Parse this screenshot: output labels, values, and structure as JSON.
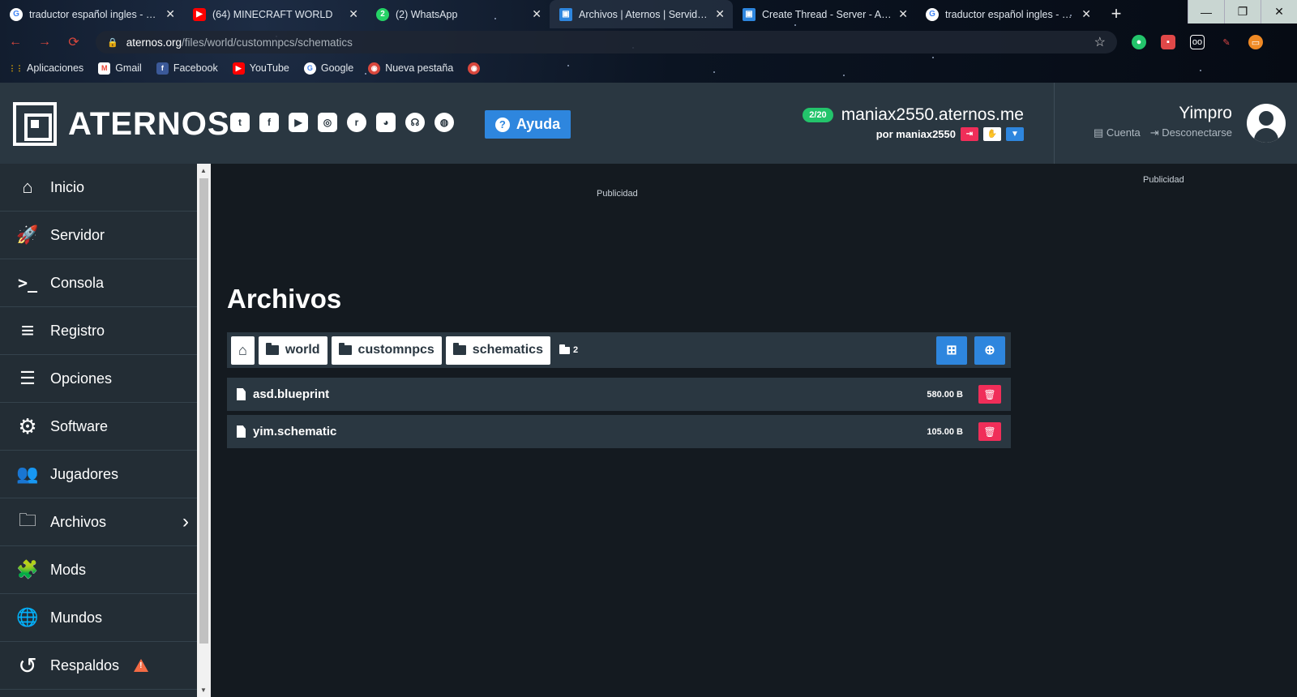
{
  "browser": {
    "tabs": [
      {
        "title": "traductor español ingles - Busc",
        "favicon": "G",
        "color": "#ffffff",
        "fg": "#4285f4",
        "active": false
      },
      {
        "title": "(64) MINECRAFT WORLD",
        "favicon": "▶",
        "color": "#ff0000",
        "fg": "#ffffff",
        "active": false
      },
      {
        "title": "(2) WhatsApp",
        "favicon": "2",
        "color": "#25d366",
        "fg": "#ffffff",
        "active": false
      },
      {
        "title": "Archivos | Aternos | Servidor d",
        "favicon": "▣",
        "color": "#2e86de",
        "fg": "#ffffff",
        "active": true
      },
      {
        "title": "Create Thread - Server - Atern",
        "favicon": "▣",
        "color": "#2e86de",
        "fg": "#ffffff",
        "active": false
      },
      {
        "title": "traductor español ingles - Busc",
        "favicon": "G",
        "color": "#ffffff",
        "fg": "#4285f4",
        "active": false
      }
    ],
    "close_glyph": "✕",
    "newtab_glyph": "+",
    "window_controls": {
      "minimize": "—",
      "restore": "❐",
      "close": "✕"
    },
    "nav": {
      "back": "←",
      "forward": "→",
      "reload": "⟳"
    },
    "url_host": "aternos.org",
    "url_path": "/files/world/customnpcs/schematics",
    "bookmarks": [
      {
        "label": "Aplicaciones",
        "icon": "apps-icon",
        "color": "#f4b400"
      },
      {
        "label": "Gmail",
        "icon": "gmail-icon",
        "color": "#ea4335"
      },
      {
        "label": "Facebook",
        "icon": "facebook-icon",
        "color": "#3b5998"
      },
      {
        "label": "YouTube",
        "icon": "youtube-icon",
        "color": "#ff0000"
      },
      {
        "label": "Google",
        "icon": "google-icon",
        "color": "#ffffff"
      },
      {
        "label": "Nueva pestaña",
        "icon": "newtab-icon",
        "color": "#d9473d"
      }
    ]
  },
  "header": {
    "logo_text": "ATERNOS",
    "help_label": "Ayuda",
    "server": {
      "players": "2/20",
      "address": "maniax2550.aternos.me",
      "owner": "por maniax2550"
    },
    "user": {
      "name": "Yimpro",
      "account": "Cuenta",
      "logout": "Desconectarse"
    }
  },
  "sidebar": {
    "items": [
      {
        "label": "Inicio",
        "icon": "home-icon",
        "glyph": "⌂"
      },
      {
        "label": "Servidor",
        "icon": "rocket-icon",
        "glyph": "🚀"
      },
      {
        "label": "Consola",
        "icon": "terminal-icon",
        "glyph": ">_"
      },
      {
        "label": "Registro",
        "icon": "log-icon",
        "glyph": "≡"
      },
      {
        "label": "Opciones",
        "icon": "sliders-icon",
        "glyph": "☰"
      },
      {
        "label": "Software",
        "icon": "gears-icon",
        "glyph": "⚙"
      },
      {
        "label": "Jugadores",
        "icon": "users-icon",
        "glyph": "👥"
      },
      {
        "label": "Archivos",
        "icon": "folder-icon",
        "glyph": "🗀"
      },
      {
        "label": "Mods",
        "icon": "puzzle-icon",
        "glyph": "🧩"
      },
      {
        "label": "Mundos",
        "icon": "globe-icon",
        "glyph": "🌐"
      },
      {
        "label": "Respaldos",
        "icon": "history-icon",
        "glyph": "↺"
      }
    ]
  },
  "main": {
    "ad_left": "Publicidad",
    "ad_right": "Publicidad",
    "title": "Archivos",
    "breadcrumb": [
      "world",
      "customnpcs",
      "schematics"
    ],
    "folder_count": "2",
    "files": [
      {
        "name": "asd.blueprint",
        "size": "580.00 B"
      },
      {
        "name": "yim.schematic",
        "size": "105.00 B"
      }
    ]
  },
  "colors": {
    "accent": "#2e86de",
    "danger": "#f02e59",
    "success": "#23c46b",
    "panel": "#2a3741"
  }
}
